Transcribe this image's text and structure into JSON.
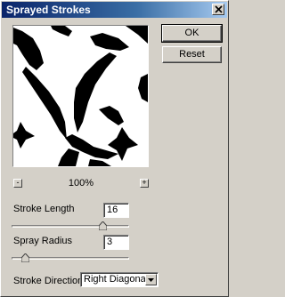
{
  "window": {
    "title": "Sprayed Strokes"
  },
  "buttons": {
    "ok": "OK",
    "reset": "Reset"
  },
  "preview": {
    "zoom": "100%",
    "zoom_out": "-",
    "zoom_in": "+"
  },
  "stroke_length": {
    "label": "Stroke Length",
    "value": "16",
    "slider_fraction": 0.78
  },
  "spray_radius": {
    "label": "Spray Radius",
    "value": "3",
    "slider_fraction": 0.12
  },
  "stroke_direction": {
    "label": "Stroke Direction:",
    "selected": "Right Diagonal"
  }
}
